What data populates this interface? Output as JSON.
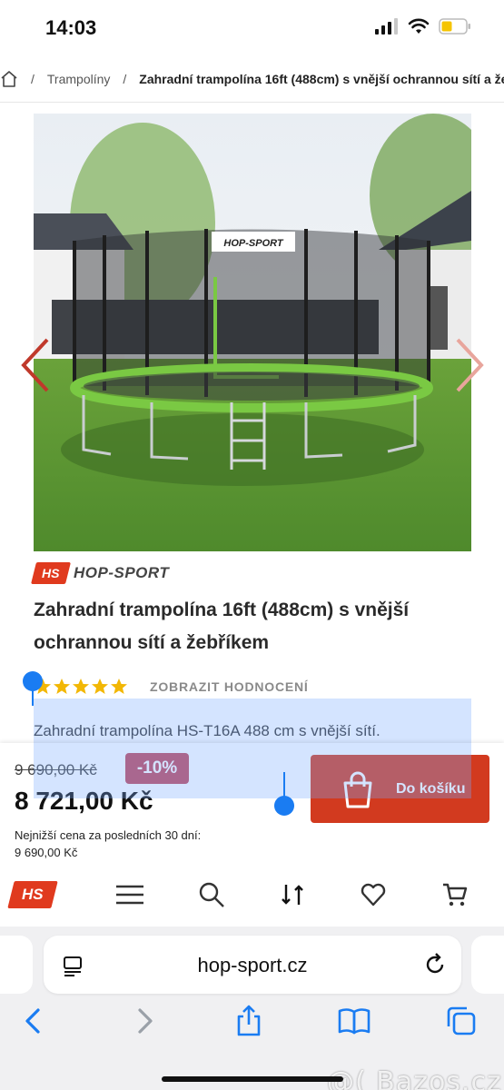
{
  "status_bar": {
    "time": "14:03",
    "icons": [
      "signal-icon",
      "wifi-icon",
      "battery-icon"
    ],
    "battery_color": "#f5c400"
  },
  "breadcrumb": {
    "category": "Trampolíny",
    "current": "Zahradní trampolína 16ft (488cm) s vnější ochrannou sítí a že"
  },
  "product": {
    "brand": "HOP-SPORT",
    "brand_mark": "HS",
    "title": "Zahradní trampolína 16ft (488cm) s vnější ochrannou sítí a žebříkem",
    "rating_stars": 5,
    "rating_link": "ZOBRAZIT HODNOCENÍ",
    "description": "Zahradní trampolína HS-T16A 488 cm s vnější sítí.",
    "image_net_label": "HOP-SPORT"
  },
  "buy_bar": {
    "old_price": "9 690,00 Kč",
    "discount": "-10%",
    "new_price": "8 721,00 Kč",
    "lowest_label": "Nejnižší cena za posledních 30 dní:",
    "lowest_value": "9 690,00 Kč",
    "cart_label": "Do košíku",
    "cart_color": "#d23a1f"
  },
  "site_nav": {
    "logo": "HS",
    "icons": [
      "menu-icon",
      "search-icon",
      "compare-icon",
      "heart-icon",
      "cart-icon"
    ]
  },
  "browser": {
    "url": "hop-sport.cz",
    "toolbar": [
      "back-icon",
      "forward-icon",
      "share-icon",
      "bookmarks-icon",
      "tabs-icon"
    ]
  },
  "watermark": "@( Bazos.cz"
}
